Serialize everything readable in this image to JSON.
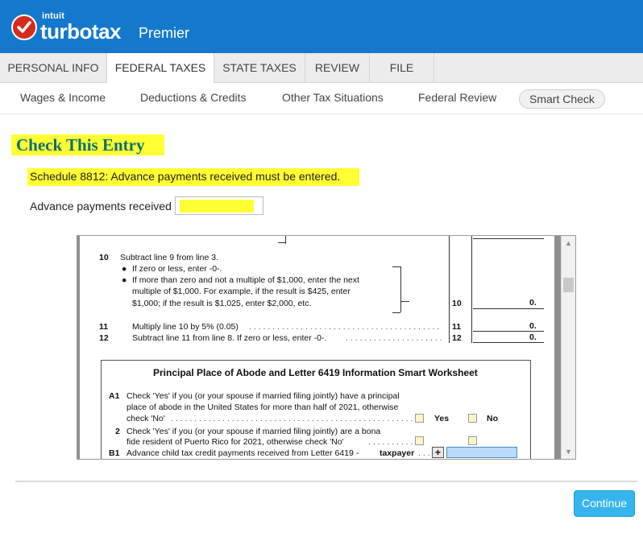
{
  "brand": {
    "company": "intuit",
    "product": "turbotax",
    "edition": "Premier",
    "colors": {
      "header": "#1479cc",
      "check": "#d52b1e",
      "title": "#0b6e74",
      "highlight": "#ffff33",
      "continue": "#35b4ee"
    }
  },
  "tabs": [
    {
      "label": "PERSONAL INFO"
    },
    {
      "label": "FEDERAL TAXES",
      "active": true
    },
    {
      "label": "STATE TAXES"
    },
    {
      "label": "REVIEW"
    },
    {
      "label": "FILE"
    }
  ],
  "subnav": [
    {
      "label": "Wages & Income"
    },
    {
      "label": "Deductions & Credits"
    },
    {
      "label": "Other Tax Situations"
    },
    {
      "label": "Federal Review"
    },
    {
      "label": "Smart Check",
      "active": true
    }
  ],
  "main": {
    "title": "Check This Entry",
    "message": "Schedule 8812: Advance payments received must be entered.",
    "field_label": "Advance payments received",
    "field_value": ""
  },
  "form": {
    "line10_num": "10",
    "line10_text": "Subtract line 9 from line 3.",
    "line10_b1": "If zero or less, enter -0-.",
    "line10_b2a": "If more than zero and not a multiple of $1,000, enter the next",
    "line10_b2b": "multiple of $1,000. For example, if the result is $425, enter",
    "line10_b2c": "$1,000; if the result is $1,025, enter $2,000, etc.",
    "line10_box": "10",
    "line10_value": "0.",
    "line11_num": "11",
    "line11_text": "Multiply line 10 by 5% (0.05)",
    "line11_box": "11",
    "line11_value": "0.",
    "line12_num": "12",
    "line12_text": "Subtract line 11 from line 8. If zero or less, enter -0-.",
    "line12_box": "12",
    "line12_value": "0.",
    "ws_title": "Principal Place of Abode and Letter 6419 Information Smart Worksheet",
    "a1_num": "A1",
    "a1_a": "Check 'Yes' if you (or your spouse if married filing jointly) have a principal",
    "a1_b": "place of abode in the United States for more than half of 2021, otherwise",
    "a1_c": "check 'No'",
    "yes": "Yes",
    "no": "No",
    "a2_num": "2",
    "a2_a": "Check 'Yes' if you (or your spouse if married filing jointly) are a bona",
    "a2_b": "fide resident of Puerto Rico for 2021, otherwise check 'No'",
    "b1_num": "B1",
    "b1_text": "Advance child tax credit payments received from Letter 6419 -",
    "b1_bold": "taxpayer"
  },
  "footer": {
    "continue_label": "Continue"
  }
}
